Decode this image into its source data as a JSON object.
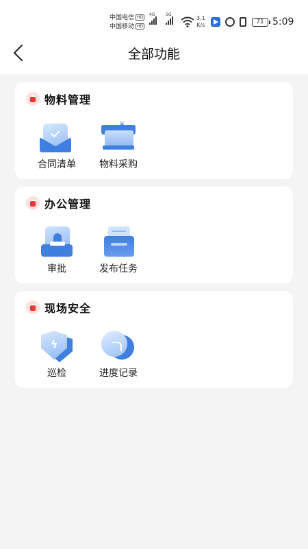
{
  "status_bar": {
    "carrier1": "中国电信",
    "carrier2": "中国移动",
    "hd": "HD",
    "net1": "4G",
    "net2": "5G",
    "speed_value": "3.1",
    "speed_unit": "K/s",
    "battery": "71",
    "time": "5:09"
  },
  "nav": {
    "title": "全部功能"
  },
  "sections": [
    {
      "title": "物料管理",
      "items": [
        {
          "label": "合同清单",
          "icon": "contract-icon"
        },
        {
          "label": "物料采购",
          "icon": "purchase-icon"
        }
      ]
    },
    {
      "title": "办公管理",
      "items": [
        {
          "label": "审批",
          "icon": "approve-icon"
        },
        {
          "label": "发布任务",
          "icon": "task-icon"
        }
      ]
    },
    {
      "title": "现场安全",
      "items": [
        {
          "label": "巡检",
          "icon": "patrol-icon"
        },
        {
          "label": "进度记录",
          "icon": "progress-icon"
        }
      ]
    }
  ],
  "colors": {
    "accent": "#3f7fe0",
    "section_icon": "#e53935",
    "background": "#f4f4f4"
  }
}
